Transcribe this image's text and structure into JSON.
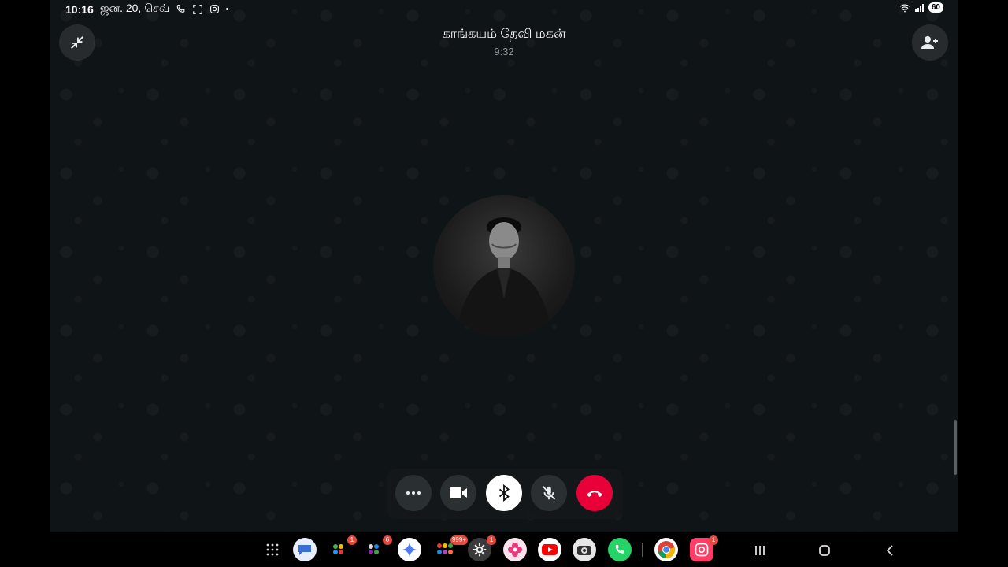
{
  "status_bar": {
    "time": "10:16",
    "date": "ஜன. 20, செவ்",
    "battery": "60",
    "icons": [
      "phone-icon",
      "screenshot-icon",
      "instagram-icon",
      "dot-icon",
      "wifi-icon",
      "signal-icon",
      "battery-icon"
    ]
  },
  "call": {
    "caller_name": "காங்கயம் தேவி மகன்",
    "duration": "9:32"
  },
  "controls": [
    "more-icon",
    "video-icon",
    "bluetooth-icon",
    "mic-off-icon",
    "end-call-icon"
  ],
  "colors": {
    "end_call": "#ea0038",
    "background": "#0f1417",
    "badge": "#e5483c"
  },
  "dock": {
    "badges": {
      "app_2": "1",
      "app_3": "6",
      "app_5": "999+",
      "settings": "1",
      "instagram": "1"
    }
  }
}
